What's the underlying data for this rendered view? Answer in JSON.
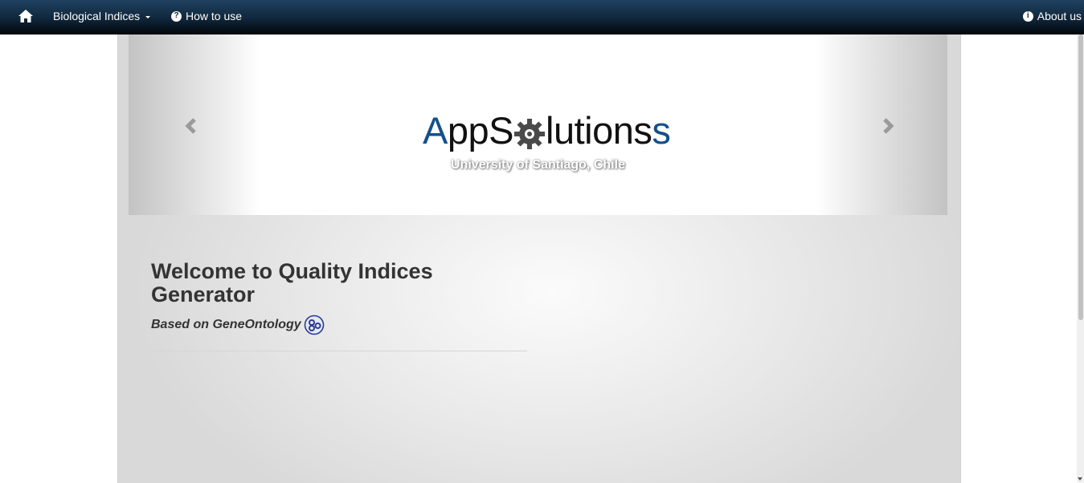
{
  "navbar": {
    "home_icon": "home-icon",
    "items": [
      {
        "label": "Biological Indices",
        "icon": "caret-down-icon"
      },
      {
        "label": "How to use",
        "icon": "question-circle-icon"
      }
    ],
    "right_item": {
      "label": "About us",
      "icon": "info-circle-icon"
    },
    "background": "#0d2437",
    "text_color": "#ffffff"
  },
  "carousel": {
    "prev_icon": "chevron-left-icon",
    "next_icon": "chevron-right-icon",
    "logo": {
      "part1": "A",
      "part2": "ppS",
      "part3": "lutions",
      "part4": "s",
      "gear_icon": "gear-icon",
      "subtitle": "University of Santiago, Chile",
      "brand_color": "#14508a"
    }
  },
  "main": {
    "title": "Welcome to Quality Indices Generator",
    "tagline": "Based on GeneOntology",
    "go_logo_icon": "gene-ontology-logo-icon"
  }
}
